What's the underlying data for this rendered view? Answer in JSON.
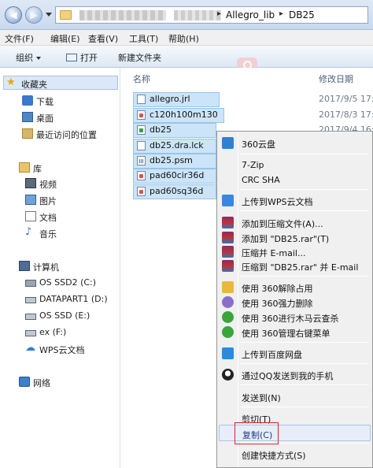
{
  "address": {
    "path": [
      "Allegro_lib",
      "DB25"
    ]
  },
  "menubar": [
    {
      "label": "文件(F)"
    },
    {
      "label": "编辑(E)"
    },
    {
      "label": "查看(V)"
    },
    {
      "label": "工具(T)"
    },
    {
      "label": "帮助(H)"
    }
  ],
  "toolbar": {
    "organize": "组织",
    "open": "打开",
    "new_folder": "新建文件夹"
  },
  "nav": {
    "favorites": "收藏夹",
    "fav_items": [
      "下载",
      "桌面",
      "最近访问的位置"
    ],
    "library": "库",
    "lib_items": [
      "视频",
      "图片",
      "文档",
      "音乐"
    ],
    "computer": "计算机",
    "drives": [
      "OS SSD2 (C:)",
      "DATAPART1 (D:)",
      "OS SSD (E:)",
      "ex (F:)",
      "WPS云文档"
    ],
    "network": "网络"
  },
  "list": {
    "col_name": "名称",
    "col_date": "修改日期",
    "files": [
      {
        "name": "allegro.jrl",
        "date": "2017/9/5 17:"
      },
      {
        "name": "c120h100m130",
        "date": "2017/8/3 17:"
      },
      {
        "name": "db25",
        "date": "2017/9/4 16:"
      },
      {
        "name": "db25.dra.lck",
        "date": ""
      },
      {
        "name": "db25.psm",
        "date": ""
      },
      {
        "name": "pad60cir36d",
        "date": ""
      },
      {
        "name": "pad60sq36d",
        "date": ""
      }
    ]
  },
  "context_menu": {
    "items": [
      {
        "label": "360云盘"
      },
      {
        "label": "7-Zip"
      },
      {
        "label": "CRC SHA"
      },
      {
        "label": "上传到WPS云文档"
      },
      {
        "label": "添加到压缩文件(A)..."
      },
      {
        "label": "添加到 \"DB25.rar\"(T)"
      },
      {
        "label": "压缩并 E-mail..."
      },
      {
        "label": "压缩到 \"DB25.rar\" 并 E-mail"
      },
      {
        "label": "使用 360解除占用"
      },
      {
        "label": "使用 360强力删除"
      },
      {
        "label": "使用 360进行木马云查杀"
      },
      {
        "label": "使用 360管理右键菜单"
      },
      {
        "label": "上传到百度网盘"
      },
      {
        "label": "通过QQ发送到我的手机"
      },
      {
        "label": "发送到(N)"
      },
      {
        "label": "剪切(T)"
      },
      {
        "label": "复制(C)"
      },
      {
        "label": "创建快捷方式(S)"
      }
    ]
  },
  "colors": {
    "selection": "#cce4f7",
    "highlight_border": "#e02020"
  }
}
